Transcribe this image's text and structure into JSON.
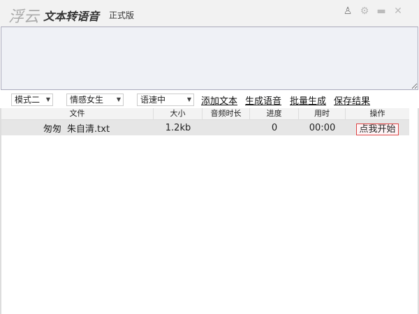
{
  "app": {
    "logo": "浮云",
    "title": "文本转语音",
    "edition": "正式版"
  },
  "title_icons": [
    "user-icon",
    "settings-icon",
    "minimize-icon",
    "close-icon"
  ],
  "toolbar": {
    "mode": "模式二",
    "voice": "情感女生",
    "speed": "语速中",
    "add_text": "添加文本",
    "generate": "生成语音",
    "batch": "批量生成",
    "save": "保存结果"
  },
  "table": {
    "headers": [
      "文件",
      "大小",
      "音频时长",
      "进度",
      "用时",
      "操作"
    ],
    "rows": [
      {
        "author": "匆匆",
        "file": "朱自清.txt",
        "size": "1.2kb",
        "duration": "",
        "progress": "0",
        "time": "00:00",
        "action": "点我开始"
      }
    ]
  }
}
